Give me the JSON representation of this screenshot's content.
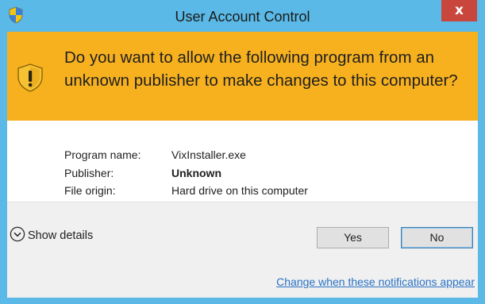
{
  "window": {
    "title": "User Account Control",
    "close_label": "x",
    "accent_color": "#5ab9e6",
    "banner_color": "#f7b11f",
    "close_color": "#c9463d"
  },
  "prompt": {
    "question": "Do you want to allow the following program from an unknown publisher to make changes to this computer?",
    "icon": "shield-warning-icon"
  },
  "details": {
    "rows": [
      {
        "label": "Program name:",
        "value": "VixInstaller.exe"
      },
      {
        "label": "Publisher:",
        "value": "Unknown"
      },
      {
        "label": "File origin:",
        "value": "Hard drive on this computer"
      }
    ]
  },
  "footer": {
    "show_details_label": "Show details",
    "yes_label": "Yes",
    "no_label": "No",
    "change_link": "Change when these notifications appear",
    "link_color": "#2a73c5"
  }
}
